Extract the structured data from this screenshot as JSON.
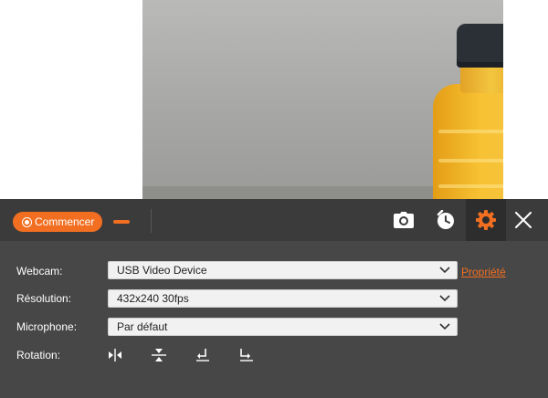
{
  "toolbar": {
    "record_label": "Commencer",
    "icons": [
      "record-icon",
      "minimize-icon",
      "camera-snapshot-icon",
      "timer-clock-icon",
      "settings-gear-icon",
      "close-icon"
    ],
    "accent_color": "#f26f21",
    "bar_color": "#3b3b3b",
    "active_tab": "settings"
  },
  "settings": {
    "webcam": {
      "label": "Webcam:",
      "value": "USB Video Device",
      "link": "Propriété"
    },
    "resolution": {
      "label": "Résolution:",
      "value": "432x240 30fps"
    },
    "microphone": {
      "label": "Microphone:",
      "value": "Par défaut"
    },
    "rotation": {
      "label": "Rotation:",
      "buttons": [
        "flip-horizontal-icon",
        "flip-vertical-icon",
        "rotate-left-icon",
        "rotate-right-icon"
      ]
    },
    "panel_color": "#474747"
  },
  "preview": {
    "subject": "webcam-preview"
  }
}
